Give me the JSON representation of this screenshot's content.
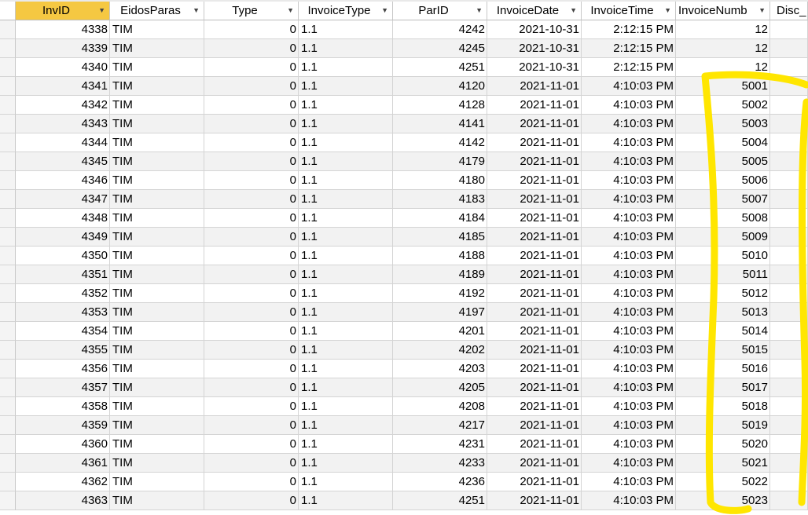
{
  "table": {
    "columns": [
      "InvID",
      "EidosParas",
      "Type",
      "InvoiceType",
      "ParID",
      "InvoiceDate",
      "InvoiceTime",
      "InvoiceNumb",
      "Disc_"
    ],
    "sorted_column": "InvID",
    "rows": [
      [
        "4338",
        "TIM",
        "0",
        "1.1",
        "4242",
        "2021-10-31",
        "2:12:15 PM",
        "12"
      ],
      [
        "4339",
        "TIM",
        "0",
        "1.1",
        "4245",
        "2021-10-31",
        "2:12:15 PM",
        "12"
      ],
      [
        "4340",
        "TIM",
        "0",
        "1.1",
        "4251",
        "2021-10-31",
        "2:12:15 PM",
        "12"
      ],
      [
        "4341",
        "TIM",
        "0",
        "1.1",
        "4120",
        "2021-11-01",
        "4:10:03 PM",
        "5001"
      ],
      [
        "4342",
        "TIM",
        "0",
        "1.1",
        "4128",
        "2021-11-01",
        "4:10:03 PM",
        "5002"
      ],
      [
        "4343",
        "TIM",
        "0",
        "1.1",
        "4141",
        "2021-11-01",
        "4:10:03 PM",
        "5003"
      ],
      [
        "4344",
        "TIM",
        "0",
        "1.1",
        "4142",
        "2021-11-01",
        "4:10:03 PM",
        "5004"
      ],
      [
        "4345",
        "TIM",
        "0",
        "1.1",
        "4179",
        "2021-11-01",
        "4:10:03 PM",
        "5005"
      ],
      [
        "4346",
        "TIM",
        "0",
        "1.1",
        "4180",
        "2021-11-01",
        "4:10:03 PM",
        "5006"
      ],
      [
        "4347",
        "TIM",
        "0",
        "1.1",
        "4183",
        "2021-11-01",
        "4:10:03 PM",
        "5007"
      ],
      [
        "4348",
        "TIM",
        "0",
        "1.1",
        "4184",
        "2021-11-01",
        "4:10:03 PM",
        "5008"
      ],
      [
        "4349",
        "TIM",
        "0",
        "1.1",
        "4185",
        "2021-11-01",
        "4:10:03 PM",
        "5009"
      ],
      [
        "4350",
        "TIM",
        "0",
        "1.1",
        "4188",
        "2021-11-01",
        "4:10:03 PM",
        "5010"
      ],
      [
        "4351",
        "TIM",
        "0",
        "1.1",
        "4189",
        "2021-11-01",
        "4:10:03 PM",
        "5011"
      ],
      [
        "4352",
        "TIM",
        "0",
        "1.1",
        "4192",
        "2021-11-01",
        "4:10:03 PM",
        "5012"
      ],
      [
        "4353",
        "TIM",
        "0",
        "1.1",
        "4197",
        "2021-11-01",
        "4:10:03 PM",
        "5013"
      ],
      [
        "4354",
        "TIM",
        "0",
        "1.1",
        "4201",
        "2021-11-01",
        "4:10:03 PM",
        "5014"
      ],
      [
        "4355",
        "TIM",
        "0",
        "1.1",
        "4202",
        "2021-11-01",
        "4:10:03 PM",
        "5015"
      ],
      [
        "4356",
        "TIM",
        "0",
        "1.1",
        "4203",
        "2021-11-01",
        "4:10:03 PM",
        "5016"
      ],
      [
        "4357",
        "TIM",
        "0",
        "1.1",
        "4205",
        "2021-11-01",
        "4:10:03 PM",
        "5017"
      ],
      [
        "4358",
        "TIM",
        "0",
        "1.1",
        "4208",
        "2021-11-01",
        "4:10:03 PM",
        "5018"
      ],
      [
        "4359",
        "TIM",
        "0",
        "1.1",
        "4217",
        "2021-11-01",
        "4:10:03 PM",
        "5019"
      ],
      [
        "4360",
        "TIM",
        "0",
        "1.1",
        "4231",
        "2021-11-01",
        "4:10:03 PM",
        "5020"
      ],
      [
        "4361",
        "TIM",
        "0",
        "1.1",
        "4233",
        "2021-11-01",
        "4:10:03 PM",
        "5021"
      ],
      [
        "4362",
        "TIM",
        "0",
        "1.1",
        "4236",
        "2021-11-01",
        "4:10:03 PM",
        "5022"
      ],
      [
        "4363",
        "TIM",
        "0",
        "1.1",
        "4251",
        "2021-11-01",
        "4:10:03 PM",
        "5023"
      ]
    ]
  },
  "colors": {
    "active_header": "#f5c842",
    "alt_row": "#f2f2f2",
    "annotation_highlight": "#ffe600"
  },
  "icons": {
    "dropdown": "chevron-down-icon"
  }
}
